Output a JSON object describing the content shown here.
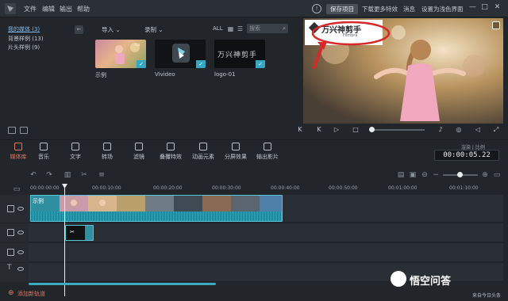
{
  "menu": {
    "file": "文件",
    "edit": "编辑",
    "export": "输出",
    "help": "帮助"
  },
  "top_right": {
    "info": "!",
    "save": "保存项目",
    "download": "下载更多特效",
    "messages": "消息",
    "easy_mode": "设置为浅色界面"
  },
  "window": {
    "minimize": "—",
    "restore": "□",
    "close": "✕"
  },
  "sidebar": {
    "items": [
      {
        "label": "我的媒体 (3)",
        "active": true
      },
      {
        "label": "背景样例 (13)",
        "active": false
      },
      {
        "label": "片头样例 (9)",
        "active": false
      }
    ],
    "collapse": "←"
  },
  "media_toolbar": {
    "import": "导入 ⌄",
    "record": "录制 ⌄",
    "all": "ALL",
    "search_placeholder": "搜索"
  },
  "media_items": [
    {
      "label": "示例"
    },
    {
      "label": "Vivideo"
    },
    {
      "label": "logo-01",
      "logo_text": "万兴神剪手"
    }
  ],
  "preview": {
    "logo_text": "万兴神剪手",
    "logo_sub": "Filmora",
    "corner_icon": "expand-icon"
  },
  "preview_controls": {
    "prev": "K",
    "rewind": "K",
    "play": "▷",
    "stop": "□",
    "mic": "♪",
    "camera": "◎",
    "volume": "◁",
    "fullscreen": "⤢"
  },
  "tools": [
    {
      "label": "媒体库",
      "active": true
    },
    {
      "label": "音乐",
      "active": false
    },
    {
      "label": "文字",
      "active": false
    },
    {
      "label": "转场",
      "active": false
    },
    {
      "label": "滤镜",
      "active": false
    },
    {
      "label": "叠覆特效",
      "active": false
    },
    {
      "label": "动画元素",
      "active": false
    },
    {
      "label": "分屏效果",
      "active": false
    },
    {
      "label": "输出影片",
      "active": false
    }
  ],
  "timecode": {
    "label": "渲染 | 比例",
    "value": "00:00:05.22"
  },
  "ruler_ticks": [
    "00:00:00:00",
    "00:00:10:00",
    "00:00:20:00",
    "00:00:30:00",
    "00:00:40:00",
    "00:00:50:00",
    "00:01:00:00",
    "00:01:10:00"
  ],
  "timeline": {
    "video_clip_label": "示例",
    "add_track": "添加新轨道"
  },
  "watermark": {
    "title": "悟空问答",
    "sub": "来自今日头条"
  },
  "colors": {
    "accent": "#e2745a",
    "clip": "#2f8fa0",
    "highlight_circle": "#d62a2a"
  }
}
